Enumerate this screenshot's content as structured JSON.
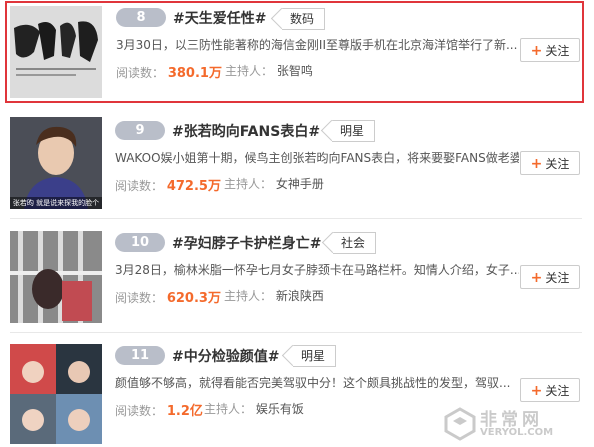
{
  "topics": [
    {
      "rank": "8",
      "title": "#天生爱任性#",
      "category": "数码",
      "description": "3月30日，以三防性能著称的海信金刚II至尊版手机在北京海洋馆举行了新...",
      "read_label": "阅读数：",
      "read_count": "380.1万",
      "host_label": "主持人：",
      "host_name": "张智鸣",
      "follow_label": "关注",
      "thumb_icon": "calligraphy-poster-image"
    },
    {
      "rank": "9",
      "title": "#张若昀向FANS表白#",
      "category": "明星",
      "description": "WAKOO娱小姐第十期，候鸟主创张若昀向FANS表白，将来要娶FANS做老婆...",
      "read_label": "阅读数：",
      "read_count": "472.5万",
      "host_label": "主持人：",
      "host_name": "女神手册",
      "follow_label": "关注",
      "thumb_icon": "actor-portrait-image",
      "thumb_caption": "张若昀 就是说来探我的脸个人"
    },
    {
      "rank": "10",
      "title": "#孕妇脖子卡护栏身亡#",
      "category": "社会",
      "description": "3月28日，榆林米脂一怀孕七月女子脖颈卡在马路栏杆。知情人介绍，女子...",
      "read_label": "阅读数：",
      "read_count": "620.3万",
      "host_label": "主持人：",
      "host_name": "新浪陕西",
      "follow_label": "关注",
      "thumb_icon": "railing-scene-image"
    },
    {
      "rank": "11",
      "title": "#中分检验颜值#",
      "category": "明星",
      "description": "颜值够不够高，就得看能否完美驾驭中分！这个颇具挑战性的发型，驾驭...",
      "read_label": "阅读数：",
      "read_count": "1.2亿",
      "host_label": "主持人：",
      "host_name": "娱乐有饭",
      "follow_label": "关注",
      "thumb_icon": "celebrity-collage-image"
    }
  ],
  "watermark": {
    "big": "非常网",
    "small": "VERYOL.COM"
  },
  "colors": {
    "accent": "#f46a2c",
    "rank_bg": "#b9bec9",
    "highlight_border": "#e0353b"
  }
}
